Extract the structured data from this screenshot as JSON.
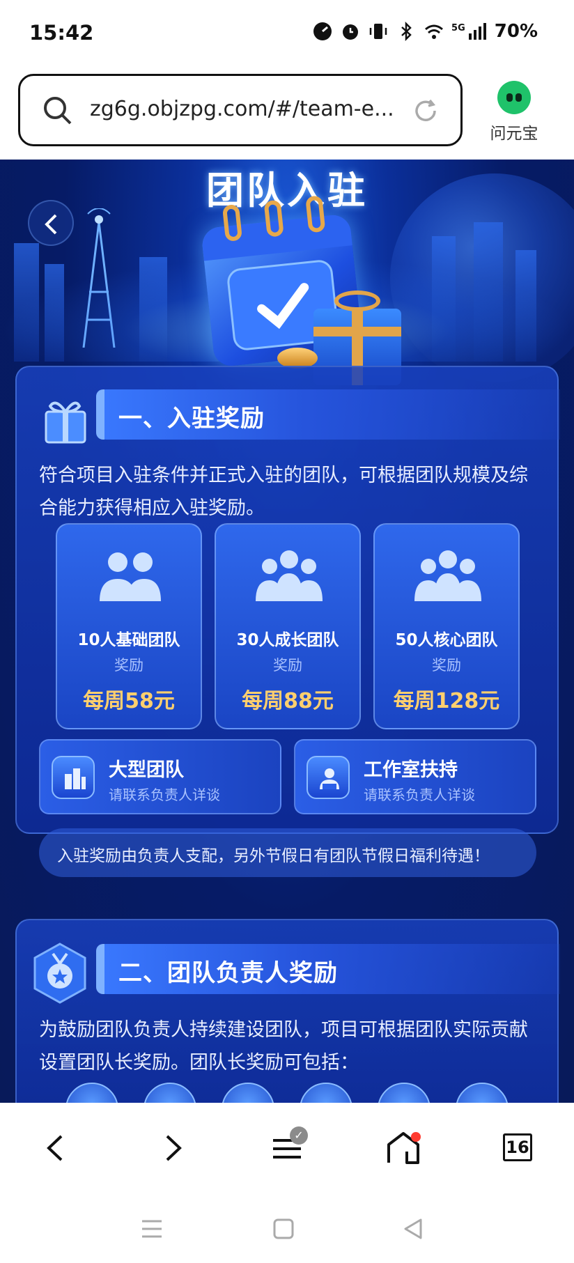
{
  "status_bar": {
    "time": "15:42",
    "network": "5G",
    "battery": "70%"
  },
  "address_bar": {
    "url": "zg6g.objzpg.com/#/team-e...",
    "assistant_label": "问元宝"
  },
  "hero": {
    "title": "团队入驻"
  },
  "section1": {
    "title": "一、入驻奖励",
    "description": "符合项目入驻条件并正式入驻的团队，可根据团队规模及综合能力获得相应入驻奖励。",
    "tiers": [
      {
        "name": "10人基础团队",
        "sub": "奖励",
        "amount": "每周58元"
      },
      {
        "name": "30人成长团队",
        "sub": "奖励",
        "amount": "每周88元"
      },
      {
        "name": "50人核心团队",
        "sub": "奖励",
        "amount": "每周128元"
      }
    ],
    "options": [
      {
        "title": "大型团队",
        "sub": "请联系负责人详谈"
      },
      {
        "title": "工作室扶持",
        "sub": "请联系负责人详谈"
      }
    ],
    "note": "入驻奖励由负责人支配，另外节假日有团队节假日福利待遇！"
  },
  "section2": {
    "title": "二、团队负责人奖励",
    "description": "为鼓励团队负责人持续建设团队，项目可根据团队实际贡献设置团队长奖励。团队长奖励可包括："
  },
  "bottom_nav": {
    "tabs_count": "16"
  },
  "colors": {
    "accent_gold": "#ffcf6e",
    "card_blue": "#1a45c4",
    "page_bg": "#061b66"
  }
}
